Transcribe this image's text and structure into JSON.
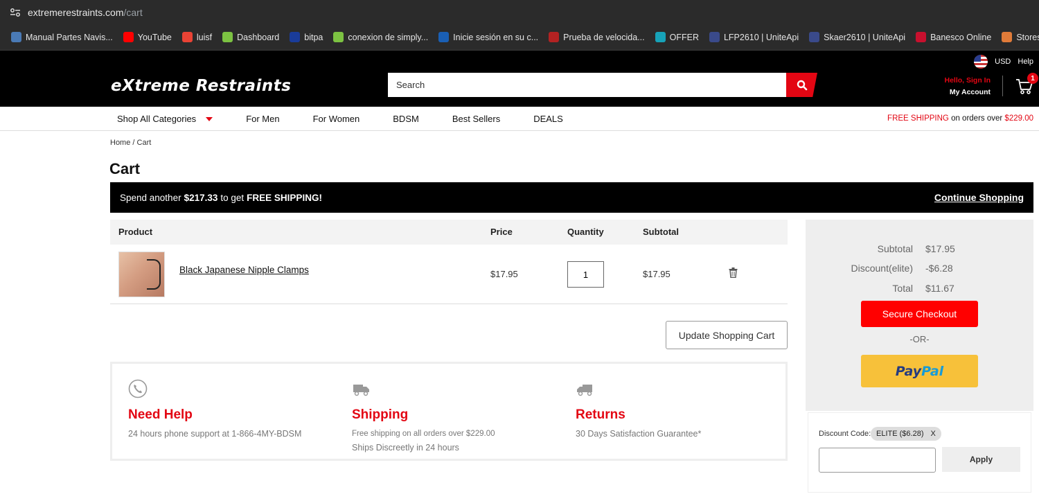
{
  "browser": {
    "url_domain": "extremerestraints.com",
    "url_path": "/cart",
    "bookmarks": [
      {
        "label": "Manual Partes Navis...",
        "icon": "globe-icon",
        "color": "#4a7ab5"
      },
      {
        "label": "YouTube",
        "icon": "youtube-icon",
        "color": "#ff0000"
      },
      {
        "label": "luisf",
        "icon": "gmail-icon",
        "color": "#ea4335"
      },
      {
        "label": "Dashboard",
        "icon": "check-circle-icon",
        "color": "#7cc242"
      },
      {
        "label": "bitpa",
        "icon": "b-logo-icon",
        "color": "#1a3c9a"
      },
      {
        "label": "conexion de simply...",
        "icon": "check-circle-icon",
        "color": "#7cc242"
      },
      {
        "label": "Inicie sesión en su c...",
        "icon": "paypal-icon",
        "color": "#1a5fb4"
      },
      {
        "label": "Prueba de velocida...",
        "icon": "speedometer-icon",
        "color": "#b22222"
      },
      {
        "label": "OFFER",
        "icon": "offer-icon",
        "color": "#17a2b8"
      },
      {
        "label": "LFP2610 | UniteApi",
        "icon": "unite-icon",
        "color": "#3a4a8a"
      },
      {
        "label": "Skaer2610 | UniteApi",
        "icon": "unite-icon",
        "color": "#3a4a8a"
      },
      {
        "label": "Banesco Online",
        "icon": "banesco-icon",
        "color": "#c8102e"
      },
      {
        "label": "Stores",
        "icon": "stores-icon",
        "color": "#e07b39"
      }
    ]
  },
  "header": {
    "currency": "USD",
    "help": "Help",
    "logo_text": "eXtreme Restraints",
    "search_placeholder": "Search",
    "hello": "Hello, Sign In",
    "my_account": "My Account",
    "cart_count": "1"
  },
  "nav": {
    "items": [
      "Shop All Categories",
      "For Men",
      "For Women",
      "BDSM",
      "Best Sellers",
      "DEALS"
    ],
    "freeship_red": "FREE SHIPPING",
    "freeship_text": " on orders over ",
    "freeship_amount": "$229.00"
  },
  "breadcrumb": "Home / Cart",
  "page_title": "Cart",
  "promo": {
    "prefix": "Spend another",
    "amount": "$217.33",
    "middle": "to get",
    "bold": "FREE SHIPPING!",
    "continue": "Continue Shopping"
  },
  "table": {
    "headers": [
      "Product",
      "Price",
      "Quantity",
      "Subtotal"
    ],
    "rows": [
      {
        "name": "Black Japanese Nipple Clamps",
        "price": "$17.95",
        "qty": "1",
        "subtotal": "$17.95"
      }
    ]
  },
  "update_button": "Update Shopping Cart",
  "info": [
    {
      "icon": "phone-icon",
      "title": "Need Help",
      "lines": [
        "24 hours phone support at 1-866-4MY-BDSM"
      ]
    },
    {
      "icon": "truck-icon",
      "title": "Shipping",
      "lines": [
        "Free shipping on all orders over $229.00",
        "Ships Discreetly in 24 hours"
      ]
    },
    {
      "icon": "return-truck-icon",
      "title": "Returns",
      "lines": [
        "30 Days Satisfaction Guarantee*"
      ]
    }
  ],
  "summary": {
    "subtotal_label": "Subtotal",
    "subtotal": "$17.95",
    "discount_label": "Discount(elite)",
    "discount": "-$6.28",
    "total_label": "Total",
    "total": "$11.67",
    "checkout": "Secure Checkout",
    "or": "-OR-",
    "paypal_1": "Pay",
    "paypal_2": "Pal"
  },
  "discount_box": {
    "label": "Discount Code:",
    "chip": "ELITE ($6.28)",
    "chip_remove": "X",
    "apply": "Apply"
  }
}
